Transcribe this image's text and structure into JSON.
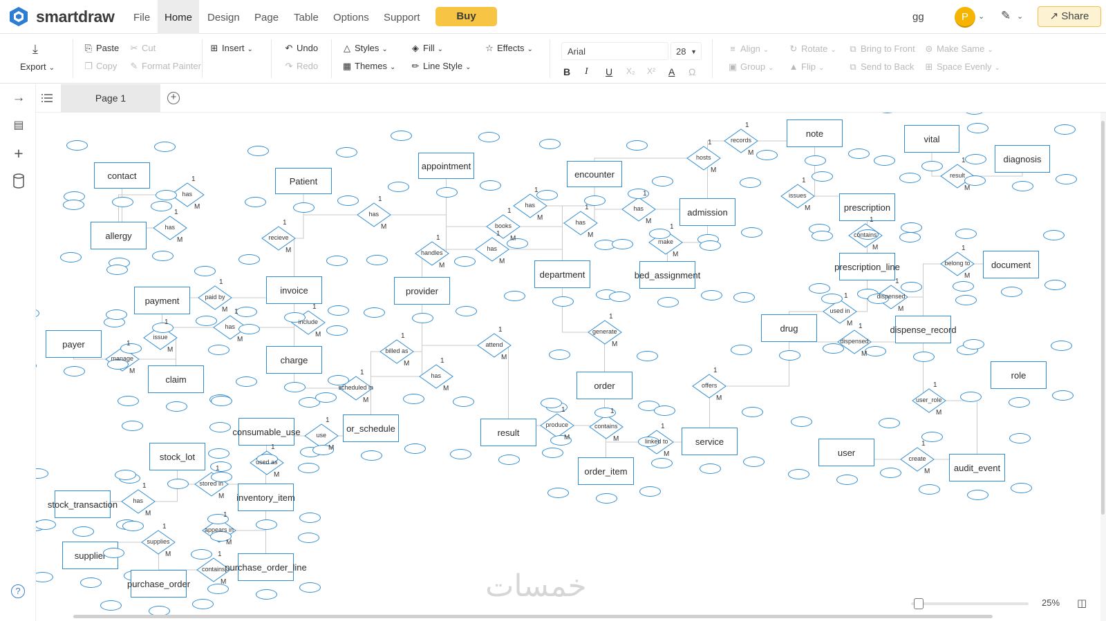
{
  "app": {
    "brand": "smartdraw"
  },
  "menu": {
    "items": [
      "File",
      "Home",
      "Design",
      "Page",
      "Table",
      "Options",
      "Support"
    ],
    "active": "Home",
    "buy": "Buy"
  },
  "user": {
    "initials": "gg",
    "avatar": "P"
  },
  "share": "Share",
  "ribbon": {
    "export": "Export",
    "paste": "Paste",
    "cut": "Cut",
    "copy": "Copy",
    "format_painter": "Format Painter",
    "insert": "Insert",
    "undo": "Undo",
    "redo": "Redo",
    "styles": "Styles",
    "themes": "Themes",
    "fill": "Fill",
    "line_style": "Line Style",
    "effects": "Effects",
    "font": "Arial",
    "font_size": "28",
    "align": "Align",
    "group": "Group",
    "rotate": "Rotate",
    "flip": "Flip",
    "bring_to_front": "Bring to Front",
    "send_to_back": "Send to Back",
    "make_same": "Make Same",
    "space_evenly": "Space Evenly"
  },
  "tabs": {
    "page": "Page 1"
  },
  "zoom": "25%",
  "watermark": "خمسات",
  "colors": {
    "accent": "#2e8bd1",
    "buy": "#f7c443"
  },
  "diagram": {
    "entities": [
      "contact",
      "Patient",
      "appointment",
      "encounter",
      "note",
      "vital",
      "diagnosis",
      "allergy",
      "admission",
      "prescription",
      "department",
      "bed_assignment",
      "prescription_line",
      "document",
      "payment",
      "invoice",
      "provider",
      "payer",
      "charge",
      "drug",
      "dispense_record",
      "claim",
      "order",
      "role",
      "consumable_use",
      "or_schedule",
      "result",
      "service",
      "user",
      "stock_lot",
      "order_item",
      "audit_event",
      "stock_transaction",
      "inventory_item",
      "supplier",
      "purchase_order_line",
      "purchase_order"
    ],
    "relationships": [
      "has",
      "has",
      "has",
      "books",
      "has",
      "hosts",
      "records",
      "has",
      "issues",
      "result",
      "recieve",
      "handles",
      "has",
      "has",
      "make",
      "contains",
      "belong to",
      "paid by",
      "dispensed",
      "has",
      "include",
      "issue",
      "attend",
      "generate",
      "used in",
      "dispensed",
      "manage",
      "billed as",
      "has",
      "scheduled in",
      "offers",
      "user_role",
      "produce",
      "contains",
      "linked to",
      "use",
      "used as",
      "create",
      "stored in",
      "has",
      "appears in",
      "supplies",
      "contains"
    ],
    "cardinality": {
      "one": "1",
      "many": "M"
    }
  }
}
